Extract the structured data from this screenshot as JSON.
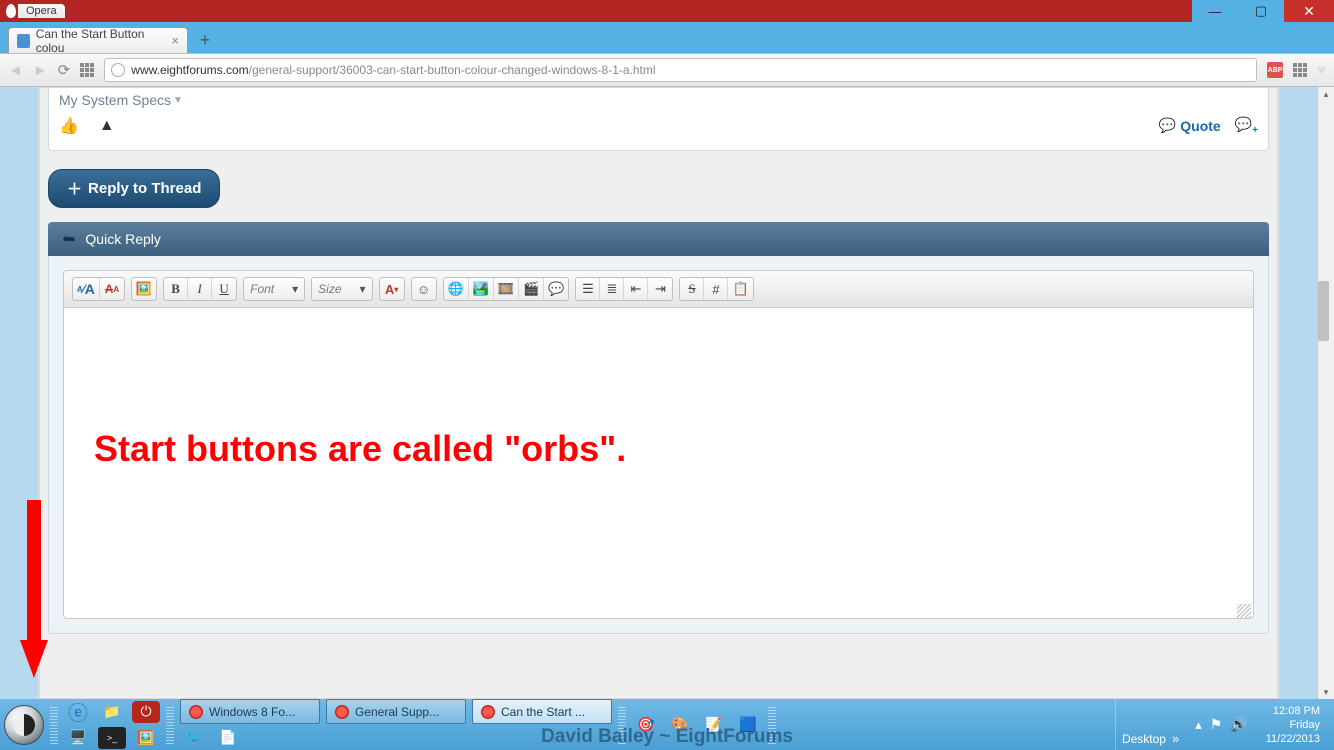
{
  "window": {
    "app_label": "Opera",
    "controls": {
      "min": "—",
      "max": "▢",
      "close": "✕"
    }
  },
  "tab": {
    "title": "Can the Start Button colou",
    "close": "×",
    "newtab": "+"
  },
  "address": {
    "url_host": "www.eightforums.com",
    "url_path": "/general-support/36003-can-start-button-colour-changed-windows-8-1-a.html"
  },
  "post": {
    "specs_label": "My System Specs",
    "quote_label": "Quote",
    "reply_button": "Reply to Thread",
    "quick_reply_label": "Quick Reply"
  },
  "editor": {
    "font_placeholder": "Font",
    "size_placeholder": "Size",
    "annotation_text": "Start buttons are called \"orbs\"."
  },
  "taskbar": {
    "buttons": [
      {
        "label": "Windows 8 Fo...",
        "active": false
      },
      {
        "label": "General Supp...",
        "active": false
      },
      {
        "label": "Can the Start ...",
        "active": true
      }
    ],
    "desktop_label": "Desktop",
    "time": "12:08 PM",
    "day": "Friday",
    "date": "11/22/2013",
    "footer": "David Bailey ~ EightForums"
  }
}
